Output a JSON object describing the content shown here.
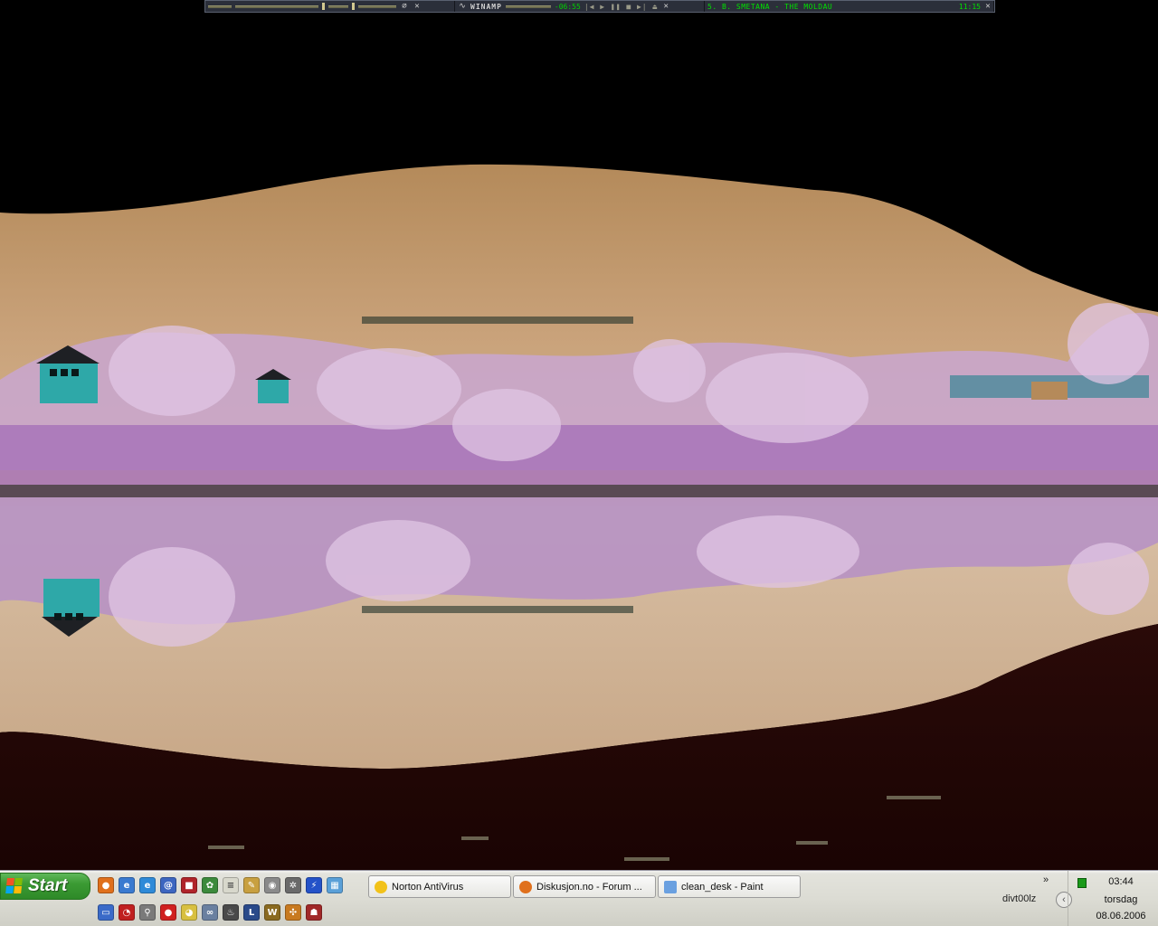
{
  "winamp": {
    "logo": "WINAMP",
    "time": "-06:55",
    "controls": "|◀ ▶ ❚❚ ■ ▶| ⏏",
    "song": "5. B. SMETANA - THE MOLDAU",
    "song_time": "11:15"
  },
  "taskbar": {
    "start_label": "Start",
    "quicklaunch_row1": [
      "firefox-icon",
      "ie-icon",
      "ie-alt-icon",
      "outlook-icon",
      "msn-icon",
      "network-icon",
      "notepad-icon",
      "pencil-icon",
      "media-icon",
      "settings-icon",
      "azureus-icon",
      "calc-icon"
    ],
    "quicklaunch_row2": [
      "window-icon",
      "speedometer-icon",
      "magnifier-icon",
      "record-icon",
      "pacman-icon",
      "chain-icon",
      "steam-icon",
      "file-icon",
      "warcraft-icon",
      "grid-icon",
      "ticket-icon"
    ],
    "tasks": [
      {
        "label": "Norton AntiVirus",
        "icon": "norton-icon"
      },
      {
        "label": "Diskusjon.no - Forum ...",
        "icon": "firefox-icon"
      },
      {
        "label": "clean_desk - Paint",
        "icon": "paint-icon"
      }
    ],
    "overflow": "»",
    "tray_user": "divt00lz",
    "clock": {
      "time": "03:44",
      "day": "torsdag",
      "date": "08.06.2006"
    }
  },
  "colors": {
    "winamp_bg": "#2b2f3a",
    "winamp_text": "#00e000",
    "start_green": "#3b9a33",
    "taskbar_silver": "#dcdcd4"
  }
}
